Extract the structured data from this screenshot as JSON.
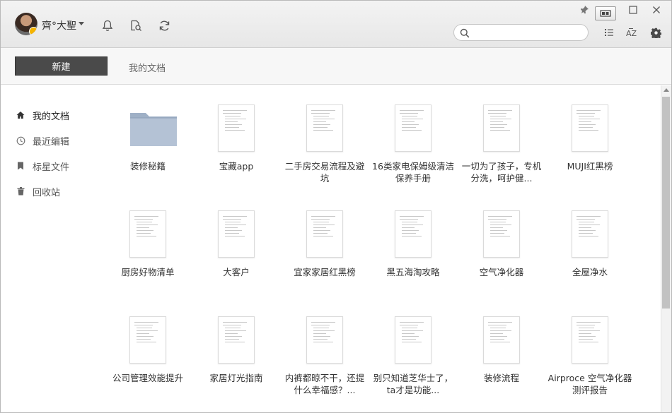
{
  "user": {
    "name": "齊°大聖"
  },
  "search": {
    "placeholder": "",
    "value": ""
  },
  "toolbar": {
    "new_label": "新建",
    "breadcrumb": "我的文档"
  },
  "sidebar": {
    "items": [
      {
        "label": "我的文档",
        "icon": "home-icon",
        "active": true
      },
      {
        "label": "最近编辑",
        "icon": "clock-icon",
        "active": false
      },
      {
        "label": "标星文件",
        "icon": "bookmark-icon",
        "active": false
      },
      {
        "label": "回收站",
        "icon": "trash-icon",
        "active": false
      }
    ]
  },
  "files": [
    {
      "label": "装修秘籍",
      "type": "folder"
    },
    {
      "label": "宝藏app",
      "type": "doc"
    },
    {
      "label": "二手房交易流程及避坑",
      "type": "doc"
    },
    {
      "label": "16类家电保姆级清洁保养手册",
      "type": "doc"
    },
    {
      "label": "一切为了孩子，专机分洗，呵护健...",
      "type": "doc"
    },
    {
      "label": "MUJI红黑榜",
      "type": "doc"
    },
    {
      "label": "厨房好物清单",
      "type": "doc"
    },
    {
      "label": "大客户",
      "type": "doc"
    },
    {
      "label": "宜家家居红黑榜",
      "type": "doc"
    },
    {
      "label": "黑五海淘攻略",
      "type": "doc"
    },
    {
      "label": "空气净化器",
      "type": "doc"
    },
    {
      "label": "全屋净水",
      "type": "doc"
    },
    {
      "label": "公司管理效能提升",
      "type": "doc"
    },
    {
      "label": "家居灯光指南",
      "type": "doc"
    },
    {
      "label": "内裤都晾不干，还提什么幸福感？...",
      "type": "doc"
    },
    {
      "label": "别只知道芝华士了，ta才是功能...",
      "type": "doc"
    },
    {
      "label": "装修流程",
      "type": "doc"
    },
    {
      "label": "Airproce 空气净化器测评报告",
      "type": "doc"
    }
  ],
  "colors": {
    "new_button": "#4a4a4a",
    "folder": "#a9b8cc",
    "badge": "#f5b400"
  }
}
